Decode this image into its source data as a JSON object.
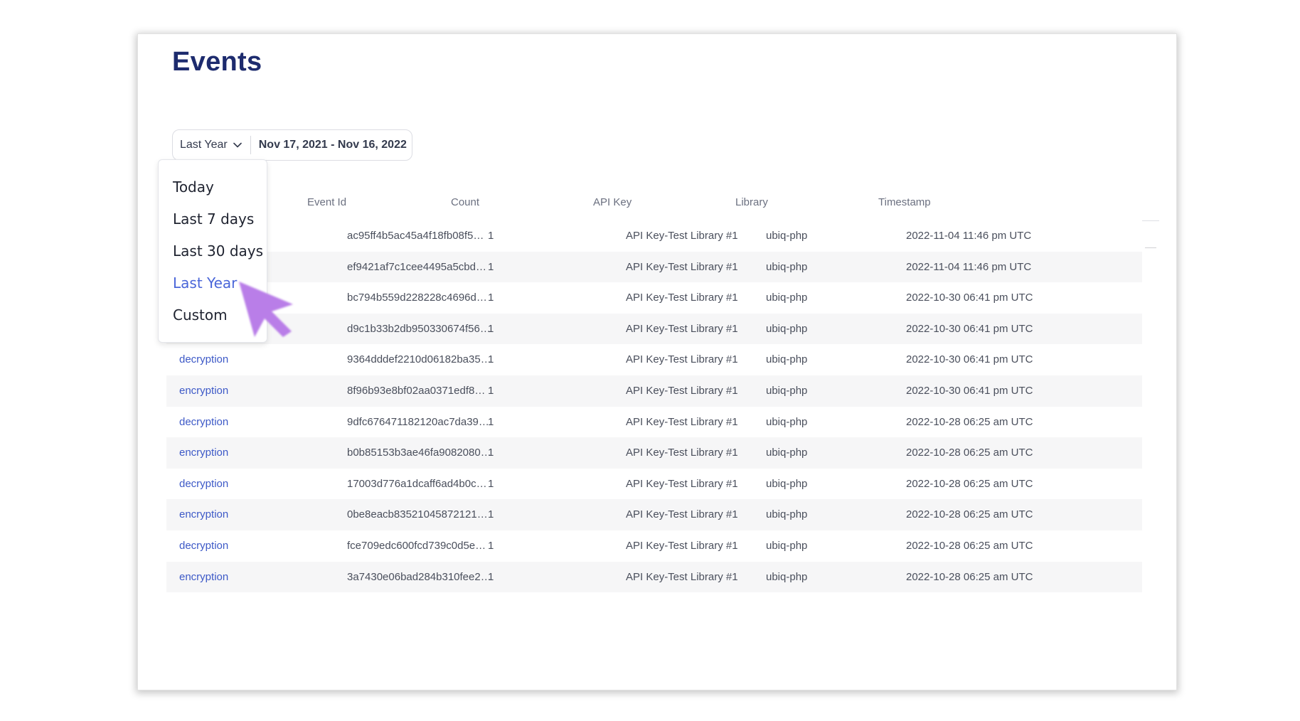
{
  "page": {
    "title": "Events"
  },
  "filter": {
    "range_label": "Last Year",
    "date_range": "Nov 17, 2021 - Nov 16, 2022",
    "options": [
      {
        "label": "Today",
        "active": false
      },
      {
        "label": "Last 7 days",
        "active": false
      },
      {
        "label": "Last 30 days",
        "active": false
      },
      {
        "label": "Last Year",
        "active": true
      },
      {
        "label": "Custom",
        "active": false
      }
    ]
  },
  "table": {
    "columns": [
      "Event Id",
      "Count",
      "API Key",
      "Library",
      "Timestamp"
    ],
    "rows": [
      {
        "type": "",
        "event_id": "ac95ff4b5ac45a4f18fb08f5…",
        "count": "1",
        "api_key": "API Key-Test Library #1",
        "library": "ubiq-php",
        "timestamp": "2022-11-04 11:46 pm UTC"
      },
      {
        "type": "",
        "event_id": "ef9421af7c1cee4495a5cbd…",
        "count": "1",
        "api_key": "API Key-Test Library #1",
        "library": "ubiq-php",
        "timestamp": "2022-11-04 11:46 pm UTC"
      },
      {
        "type": "",
        "event_id": "bc794b559d228228c4696d…",
        "count": "1",
        "api_key": "API Key-Test Library #1",
        "library": "ubiq-php",
        "timestamp": "2022-10-30 06:41 pm UTC"
      },
      {
        "type": "",
        "event_id": "d9c1b33b2db950330674f56…",
        "count": "1",
        "api_key": "API Key-Test Library #1",
        "library": "ubiq-php",
        "timestamp": "2022-10-30 06:41 pm UTC"
      },
      {
        "type": "decryption",
        "event_id": "9364dddef2210d06182ba35…",
        "count": "1",
        "api_key": "API Key-Test Library #1",
        "library": "ubiq-php",
        "timestamp": "2022-10-30 06:41 pm UTC"
      },
      {
        "type": "encryption",
        "event_id": "8f96b93e8bf02aa0371edf8…",
        "count": "1",
        "api_key": "API Key-Test Library #1",
        "library": "ubiq-php",
        "timestamp": "2022-10-30 06:41 pm UTC"
      },
      {
        "type": "decryption",
        "event_id": "9dfc676471182120ac7da39…",
        "count": "1",
        "api_key": "API Key-Test Library #1",
        "library": "ubiq-php",
        "timestamp": "2022-10-28 06:25 am UTC"
      },
      {
        "type": "encryption",
        "event_id": "b0b85153b3ae46fa9082080…",
        "count": "1",
        "api_key": "API Key-Test Library #1",
        "library": "ubiq-php",
        "timestamp": "2022-10-28 06:25 am UTC"
      },
      {
        "type": "decryption",
        "event_id": "17003d776a1dcaff6ad4b0c…",
        "count": "1",
        "api_key": "API Key-Test Library #1",
        "library": "ubiq-php",
        "timestamp": "2022-10-28 06:25 am UTC"
      },
      {
        "type": "encryption",
        "event_id": "0be8eacb83521045872121…",
        "count": "1",
        "api_key": "API Key-Test Library #1",
        "library": "ubiq-php",
        "timestamp": "2022-10-28 06:25 am UTC"
      },
      {
        "type": "decryption",
        "event_id": "fce709edc600fcd739c0d5e…",
        "count": "1",
        "api_key": "API Key-Test Library #1",
        "library": "ubiq-php",
        "timestamp": "2022-10-28 06:25 am UTC"
      },
      {
        "type": "encryption",
        "event_id": "3a7430e06bad284b310fee2…",
        "count": "1",
        "api_key": "API Key-Test Library #1",
        "library": "ubiq-php",
        "timestamp": "2022-10-28 06:25 am UTC"
      }
    ]
  },
  "icons": {
    "chevron": "chevron-down-icon",
    "pointer": "cursor-arrow-icon"
  },
  "colors": {
    "title": "#1d2b6e",
    "link": "#3d59c7",
    "active_option": "#4a66d9",
    "cursor": "#b97ee8"
  }
}
